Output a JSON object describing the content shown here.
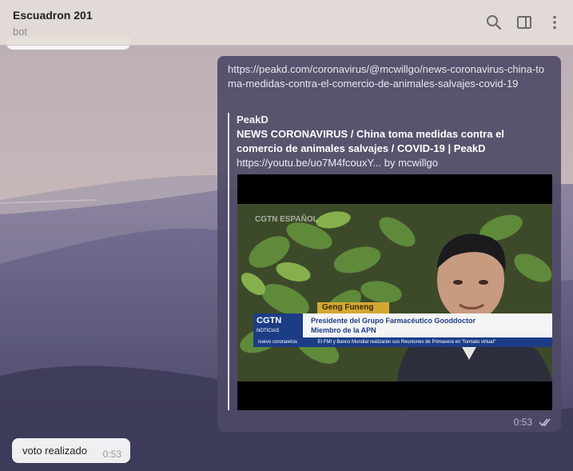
{
  "header": {
    "title": "Escuadron 201",
    "subtitle": "bot"
  },
  "icons": {
    "search": "search-icon",
    "panel": "sidebar-panel-icon",
    "menu": "more-vertical-icon"
  },
  "outgoing_message": {
    "link": "https://peakd.com/coronavirus/@mcwillgo/news-coronavirus-china-toma-medidas-contra-el-comercio-de-animales-salvajes-covid-19",
    "preview": {
      "site": "PeakD",
      "title": "NEWS CORONAVIRUS / China toma medidas contra el comercio de animales salvajes / COVID-19 | PeakD",
      "description": "https://youtu.be/uo7M4fcouxY... by mcwillgo"
    },
    "video": {
      "watermark": "CGTN ESPAÑOL",
      "lower_third_name": "Geng Funeng",
      "channel_logo": "CGTN",
      "channel_logo_sub": "NOTICIAS",
      "role_line1": "Presidente del Grupo Farmacéutico Gooddoctor",
      "role_line2": "Miembro de la APN",
      "ticker_tag": "nuevo coronavirus",
      "ticker_news": "El FMI y Banco Mundial realizarán sus Reuniones de Primavera en \"formato virtual\""
    },
    "time": "0:53",
    "status": "read"
  },
  "incoming_message": {
    "text": "voto realizado",
    "time": "0:53"
  },
  "colors": {
    "outgoing_bubble": "#4e4866",
    "incoming_bubble": "#ffffff",
    "header_bg": "#e4ded8"
  }
}
